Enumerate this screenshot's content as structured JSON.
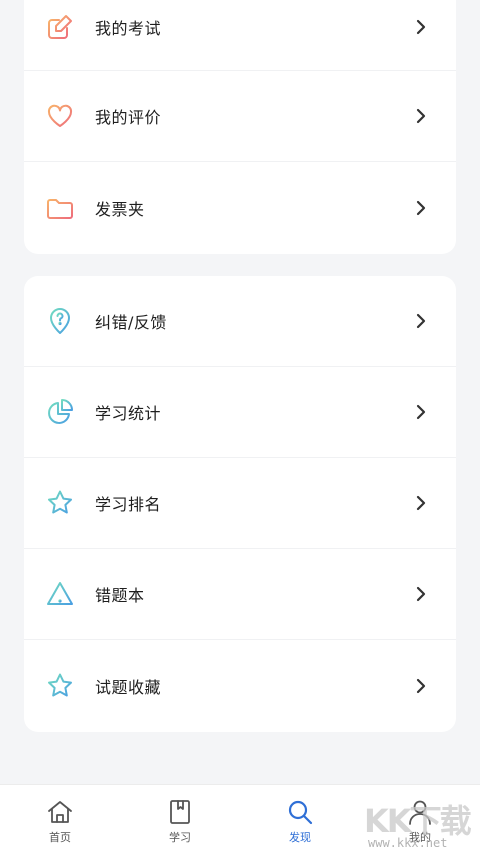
{
  "group1": {
    "items": [
      {
        "label": "我的考试",
        "icon": "edit-icon"
      },
      {
        "label": "我的评价",
        "icon": "heart-icon"
      },
      {
        "label": "发票夹",
        "icon": "folder-icon"
      }
    ]
  },
  "group2": {
    "items": [
      {
        "label": "纠错/反馈",
        "icon": "location-question-icon"
      },
      {
        "label": "学习统计",
        "icon": "pie-chart-icon"
      },
      {
        "label": "学习排名",
        "icon": "star-icon"
      },
      {
        "label": "错题本",
        "icon": "warning-icon"
      },
      {
        "label": "试题收藏",
        "icon": "star-icon"
      }
    ]
  },
  "tabbar": {
    "tabs": [
      {
        "label": "首页",
        "icon": "home-icon"
      },
      {
        "label": "学习",
        "icon": "book-icon"
      },
      {
        "label": "发现",
        "icon": "search-icon"
      },
      {
        "label": "我的",
        "icon": "user-icon"
      }
    ],
    "active_index": 2
  },
  "watermark": {
    "logo": "KK下载",
    "url": "www.kkx.net"
  },
  "colors": {
    "accent": "#2f6fd6",
    "icon_warm_start": "#f7a06a",
    "icon_warm_end": "#ef6f7c",
    "icon_cool_start": "#6dd6c6",
    "icon_cool_end": "#4aa8e0"
  }
}
